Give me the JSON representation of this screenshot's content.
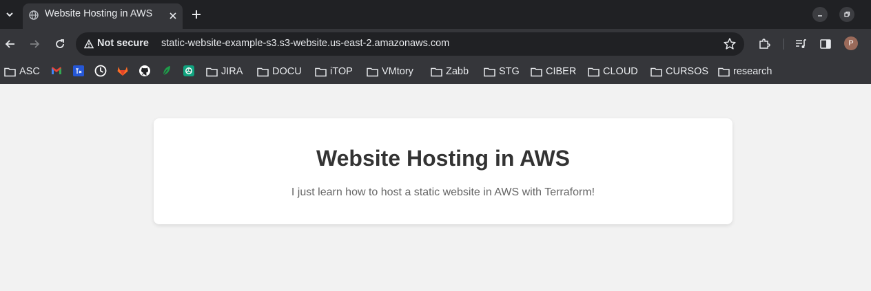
{
  "browser": {
    "tab": {
      "title": "Website Hosting in AWS"
    },
    "omnibox": {
      "security_label": "Not secure",
      "url": "static-website-example-s3.s3-website.us-east-2.amazonaws.com"
    },
    "avatar_initial": "P"
  },
  "bookmarks": [
    {
      "label": "ASC",
      "kind": "folder"
    },
    {
      "icon": "gmail-icon"
    },
    {
      "icon": "app-icon"
    },
    {
      "icon": "clock-icon"
    },
    {
      "icon": "gitlab-icon"
    },
    {
      "icon": "github-icon"
    },
    {
      "icon": "leaf-icon"
    },
    {
      "icon": "openai-icon"
    },
    {
      "label": "JIRA",
      "kind": "folder"
    },
    {
      "label": "DOCU",
      "kind": "folder"
    },
    {
      "label": "iTOP",
      "kind": "folder"
    },
    {
      "label": "VMtory",
      "kind": "folder"
    },
    {
      "label": "Zabb",
      "kind": "folder"
    },
    {
      "label": "STG",
      "kind": "folder"
    },
    {
      "label": "CIBER",
      "kind": "folder"
    },
    {
      "label": "CLOUD",
      "kind": "folder"
    },
    {
      "label": "CURSOS",
      "kind": "folder"
    },
    {
      "label": "research",
      "kind": "folder"
    }
  ],
  "page": {
    "heading": "Website Hosting in AWS",
    "text": "I just learn how to host a static website in AWS with Terraform!"
  },
  "colors": {
    "tabstrip": "#202124",
    "toolbar": "#35363a",
    "page_bg": "#f2f2f2",
    "card_bg": "#ffffff",
    "heading": "#333333",
    "text": "#666666"
  }
}
